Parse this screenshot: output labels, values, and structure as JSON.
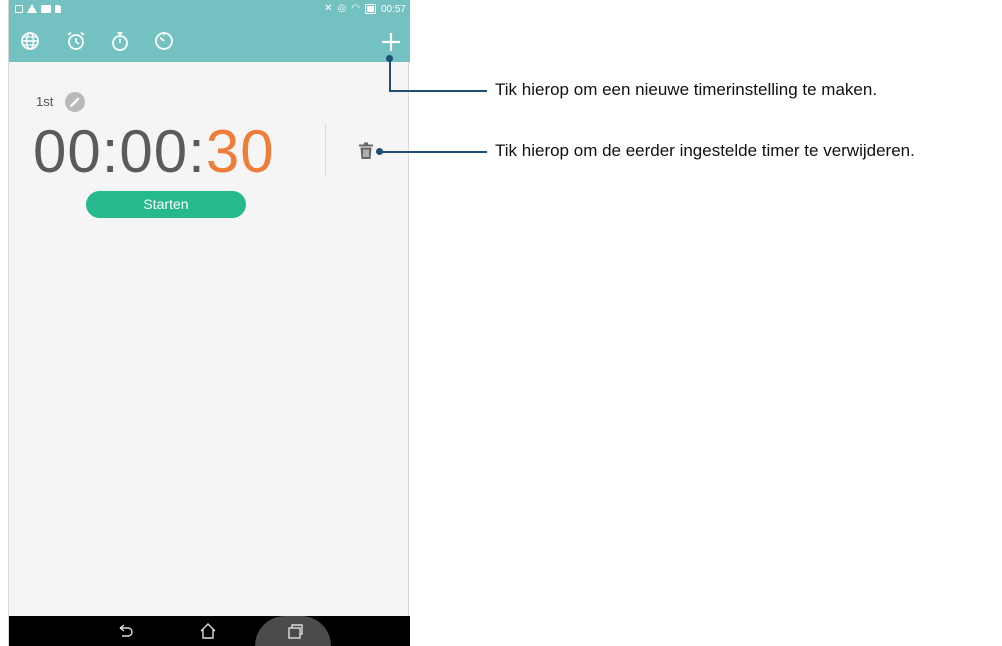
{
  "status_bar": {
    "time": "00:57"
  },
  "app_bar": {
    "tabs": [
      {
        "icon": "globe-icon"
      },
      {
        "icon": "alarm-clock-icon"
      },
      {
        "icon": "stopwatch-icon"
      },
      {
        "icon": "timer-icon"
      }
    ],
    "add_icon": "plus-icon",
    "accent_color": "#74c1c2"
  },
  "timer": {
    "label": "1st",
    "hours_minutes": "00:00:",
    "seconds": "30",
    "seconds_color": "#ee7d3a",
    "start_label": "Starten",
    "start_color": "#26b98d"
  },
  "nav_bar": {
    "buttons": [
      "back-icon",
      "home-icon",
      "recent-apps-icon"
    ]
  },
  "annotations": {
    "add_timer": "Tik hierop om een nieuwe timerinstelling te maken.",
    "delete_timer": "Tik hierop om de eerder ingestelde timer te verwijderen."
  }
}
